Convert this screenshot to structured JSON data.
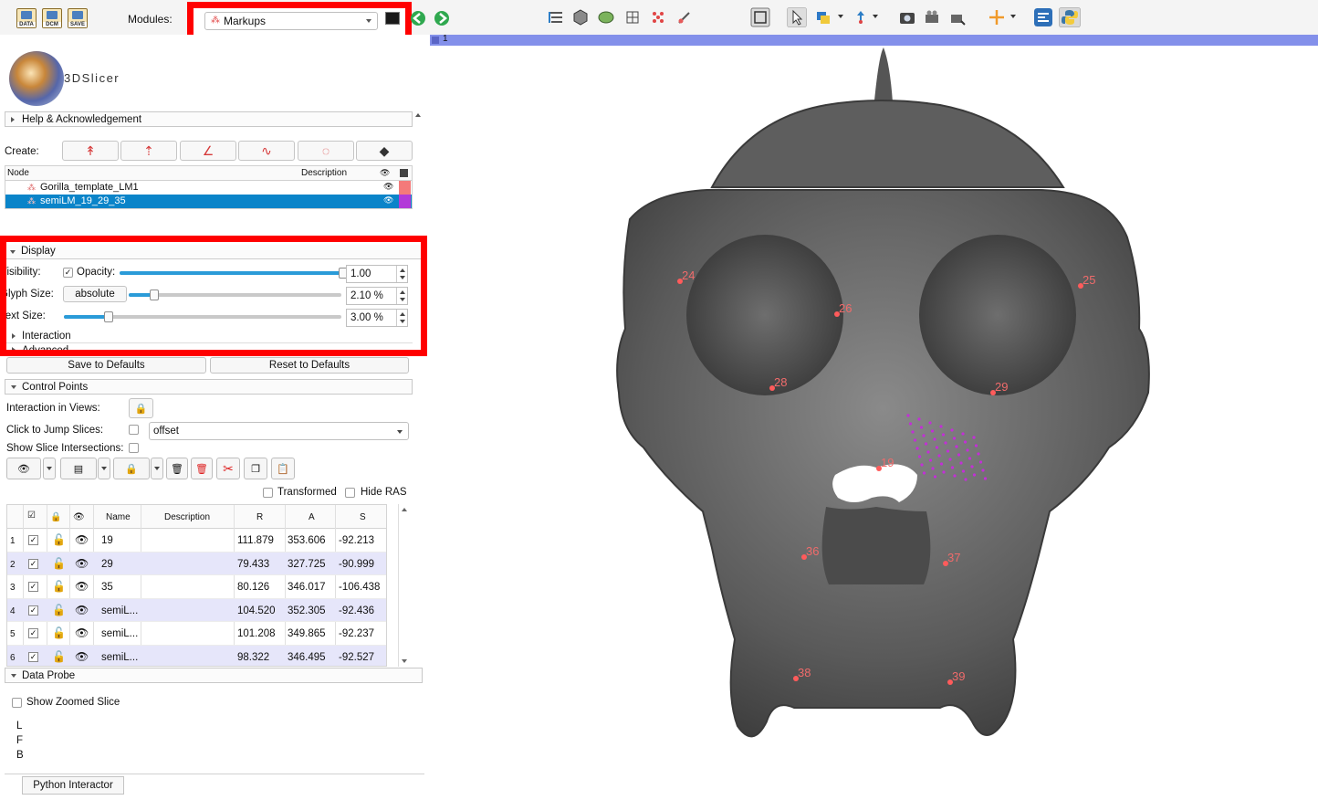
{
  "toolbar": {
    "data_btn": "DATA",
    "dcm_btn": "DCM",
    "save_btn": "SAVE",
    "modules_label": "Modules:",
    "module_selected": "Markups"
  },
  "app": {
    "logo_text": "3DSlicer"
  },
  "help_section": {
    "label": "Help & Acknowledgement"
  },
  "create": {
    "label": "Create:"
  },
  "node_table": {
    "headers": {
      "node": "Node",
      "description": "Description"
    },
    "rows": [
      {
        "name": "Gorilla_template_LM1",
        "color": "#f47a7a"
      },
      {
        "name": "semiLM_19_29_35",
        "color": "#b23ad8"
      }
    ]
  },
  "display": {
    "section_label": "Display",
    "visibility_label": "Visibility:",
    "opacity_label": "Opacity:",
    "opacity_value": "1.00",
    "opacity_fraction": 1.0,
    "glyph_size_label": "Glyph Size:",
    "glyph_mode": "absolute",
    "glyph_value": "2.10 %",
    "glyph_fraction": 0.12,
    "text_size_label": "Text Size:",
    "text_value": "3.00 %",
    "text_fraction": 0.16,
    "interaction_label": "Interaction",
    "advanced_label": "Advanced"
  },
  "defaults": {
    "save": "Save to Defaults",
    "reset": "Reset to Defaults"
  },
  "control_points": {
    "section_label": "Control Points",
    "interaction_views_label": "Interaction in Views:",
    "jump_slices_label": "Click to Jump Slices:",
    "jump_mode": "offset",
    "show_slice_label": "Show Slice Intersections:",
    "transformed_label": "Transformed",
    "hide_ras_label": "Hide RAS",
    "table_headers": {
      "name": "Name",
      "description": "Description",
      "r": "R",
      "a": "A",
      "s": "S"
    },
    "rows": [
      {
        "n": "1",
        "name": "19",
        "r": "111.879",
        "a": "353.606",
        "s": "-92.213"
      },
      {
        "n": "2",
        "name": "29",
        "r": "79.433",
        "a": "327.725",
        "s": "-90.999"
      },
      {
        "n": "3",
        "name": "35",
        "r": "80.126",
        "a": "346.017",
        "s": "-106.438"
      },
      {
        "n": "4",
        "name": "semiL...",
        "r": "104.520",
        "a": "352.305",
        "s": "-92.436"
      },
      {
        "n": "5",
        "name": "semiL...",
        "r": "101.208",
        "a": "349.865",
        "s": "-92.237"
      },
      {
        "n": "6",
        "name": "semiL...",
        "r": "98.322",
        "a": "346.495",
        "s": "-92.527"
      }
    ]
  },
  "data_probe": {
    "section_label": "Data Probe",
    "show_zoomed_label": "Show Zoomed Slice",
    "lines": [
      "L",
      "F",
      "B"
    ]
  },
  "python_tab": "Python Interactor",
  "view": {
    "number": "1",
    "landmarks": [
      "24",
      "25",
      "26",
      "28",
      "29",
      "19",
      "36",
      "37",
      "38",
      "39"
    ]
  }
}
